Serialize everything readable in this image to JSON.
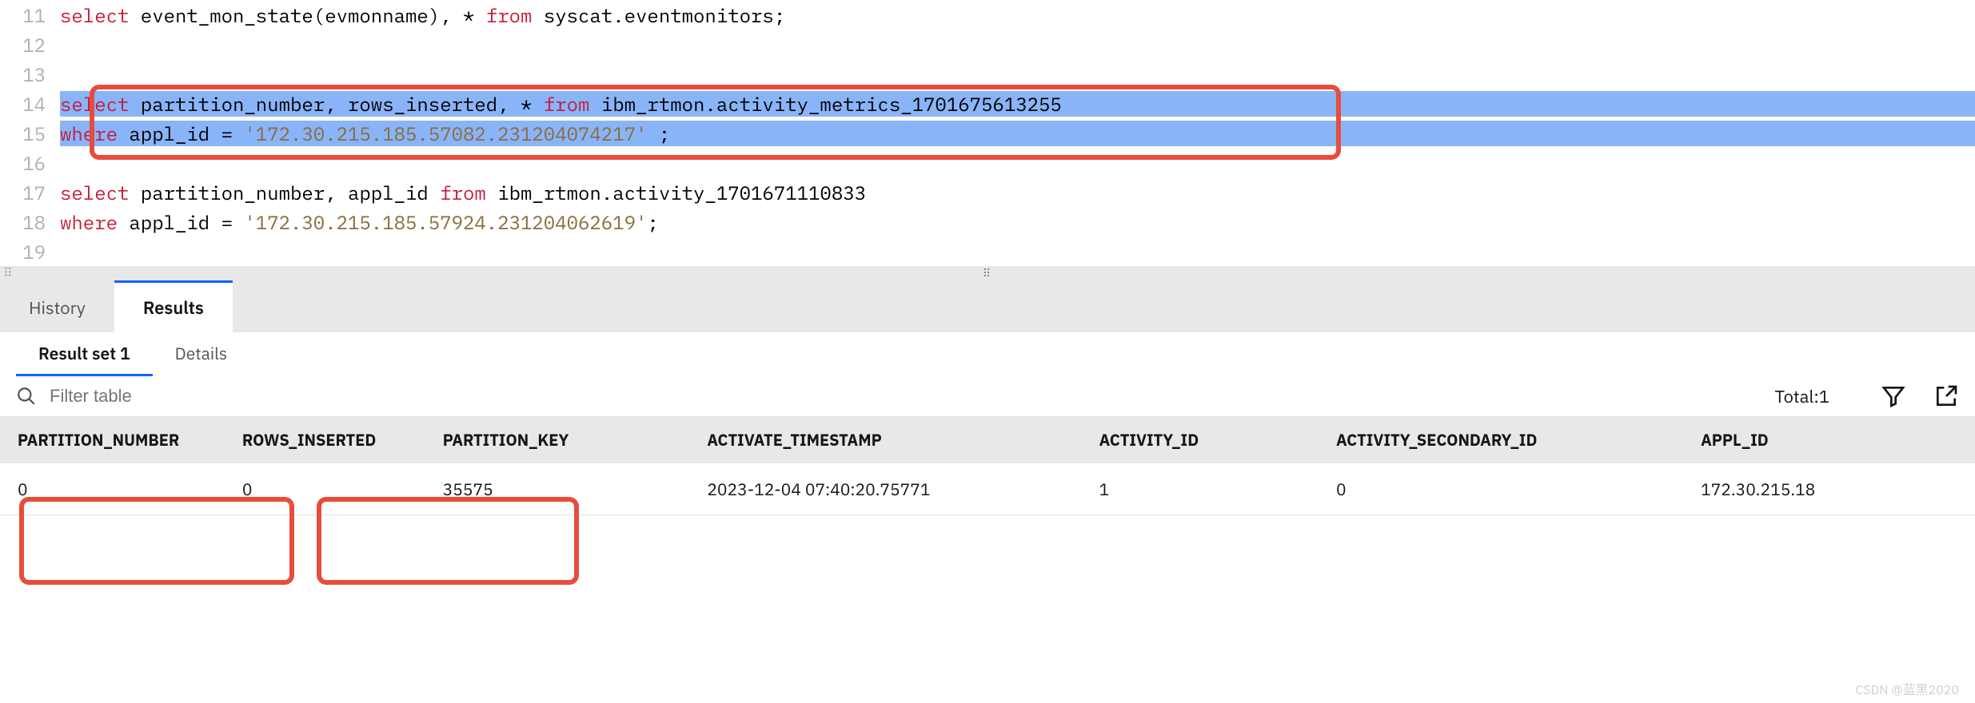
{
  "editor": {
    "lines": [
      {
        "num": "11",
        "html": "<span class='kw'>select</span> event_mon_state(evmonname), * <span class='kw'>from</span> syscat.eventmonitors;"
      },
      {
        "num": "12",
        "html": ""
      },
      {
        "num": "13",
        "html": ""
      },
      {
        "num": "14",
        "html": "<span class='kw'>select</span> partition_number, rows_inserted, * <span class='kw'>from</span> ibm_rtmon.activity_metrics_1701675613255",
        "highlighted": true
      },
      {
        "num": "15",
        "html": "<span class='kw'>where</span> appl_id = <span class='str'>'172.30.215.185.57082.231204074217'</span> ;",
        "highlighted": true
      },
      {
        "num": "16",
        "html": ""
      },
      {
        "num": "17",
        "html": "<span class='kw'>select</span> partition_number, appl_id <span class='kw'>from</span> ibm_rtmon.activity_1701671110833"
      },
      {
        "num": "18",
        "html": "<span class='kw'>where</span> appl_id = <span class='str'>'172.30.215.185.57924.231204062619'</span>;"
      },
      {
        "num": "19",
        "html": ""
      }
    ]
  },
  "tabs": {
    "history": "History",
    "results": "Results"
  },
  "subtabs": {
    "result_set": "Result set 1",
    "details": "Details"
  },
  "filter": {
    "placeholder": "Filter table",
    "total_label": "Total:1"
  },
  "table": {
    "headers": [
      "PARTITION_NUMBER",
      "ROWS_INSERTED",
      "PARTITION_KEY",
      "ACTIVATE_TIMESTAMP",
      "ACTIVITY_ID",
      "ACTIVITY_SECONDARY_ID",
      "APPL_ID"
    ],
    "rows": [
      [
        "0",
        "0",
        "35575",
        "2023-12-04 07:40:20.75771",
        "1",
        "0",
        "172.30.215.18"
      ]
    ]
  },
  "watermark": "CSDN @蓝黑2020"
}
